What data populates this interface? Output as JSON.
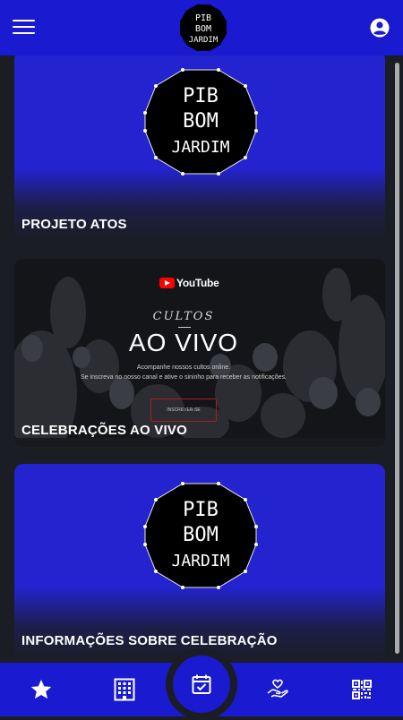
{
  "header": {
    "logo_lines": [
      "PIB",
      "BOM",
      "JARDIM"
    ],
    "menu_icon": "hamburger-menu-icon",
    "account_icon": "account-circle-icon"
  },
  "cards": [
    {
      "title": "PROJETO ATOS",
      "logo_lines": [
        "PIB",
        "BOM",
        "JARDIM"
      ]
    },
    {
      "title": "CELEBRAÇÕES AO VIVO",
      "banner": {
        "youtube": "YouTube",
        "cultos": "CULTOS",
        "heading": "AO VIVO",
        "line1": "Acompanhe nossos cultos online.",
        "line2": "Se inscreva no nosso canal e ative o sininho para receber as notificações.",
        "button": "INSCREVER-SE"
      }
    },
    {
      "title": "INFORMAÇÕES SOBRE CELEBRAÇÃO",
      "logo_lines": [
        "PIB",
        "BOM",
        "JARDIM"
      ]
    }
  ],
  "bottom_nav": {
    "items": [
      "star-icon",
      "building-icon",
      "calendar-check-icon",
      "heart-hand-icon",
      "qr-code-icon"
    ],
    "active": "calendar-check-icon"
  },
  "colors": {
    "brand_blue": "#1a1ad0",
    "background": "#1b1d24",
    "youtube_red": "#ff0000"
  }
}
